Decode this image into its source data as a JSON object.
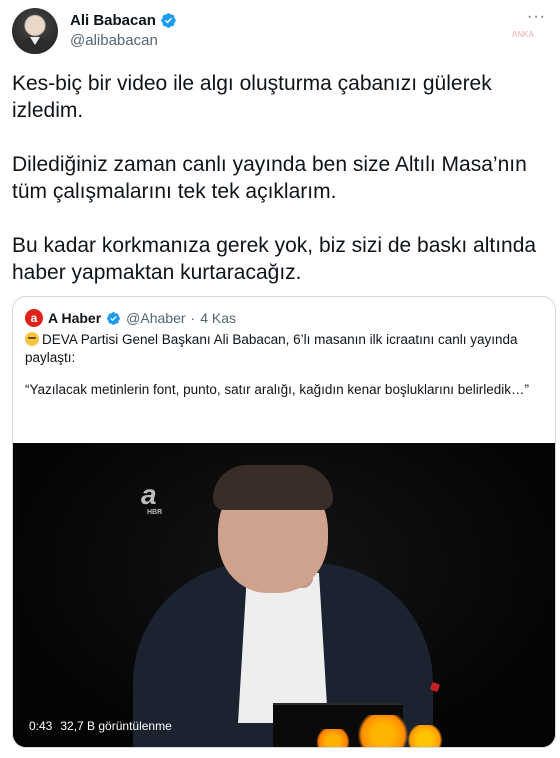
{
  "tweet": {
    "author": {
      "display_name": "Ali Babacan",
      "handle": "@alibabacan",
      "verified": true,
      "avatar_icon": "user-avatar"
    },
    "more_icon": "more-dots-icon",
    "more_glyph": "···",
    "watermark": "ANKA",
    "paragraphs": [
      "Kes-biç bir video ile algı oluşturma çabanızı gülerek izledim.",
      "Dilediğiniz zaman canlı yayında ben size Altılı Masa’nın tüm çalışmalarını tek tek açıklarım.",
      "Bu kadar korkmanıza gerek yok, biz sizi de baskı altında haber yapmaktan kurtaracağız."
    ]
  },
  "quoted_tweet": {
    "author": {
      "display_name": "A Haber",
      "handle": "@Ahaber",
      "verified": true,
      "logo_letter": "a"
    },
    "separator": "·",
    "date": "4 Kas",
    "paragraphs": [
      "DEVA Partisi Genel Başkanı Ali Babacan, 6’lı masanın ilk icraatını canlı yayında paylaştı:",
      "“Yazılacak metinlerin font, punto, satır aralığı, kağıdın kenar boşluklarını belirledik…”"
    ],
    "video": {
      "duration": "0:43",
      "views": "32,7 B görüntülenme",
      "channel_logo": "a",
      "channel_logo_sub": "HBR"
    }
  },
  "colors": {
    "verified_blue": "#1d9bf0",
    "text_primary": "#0f1419",
    "text_secondary": "#536471",
    "border": "#cfd9de",
    "ahaber_red": "#e0241b"
  }
}
